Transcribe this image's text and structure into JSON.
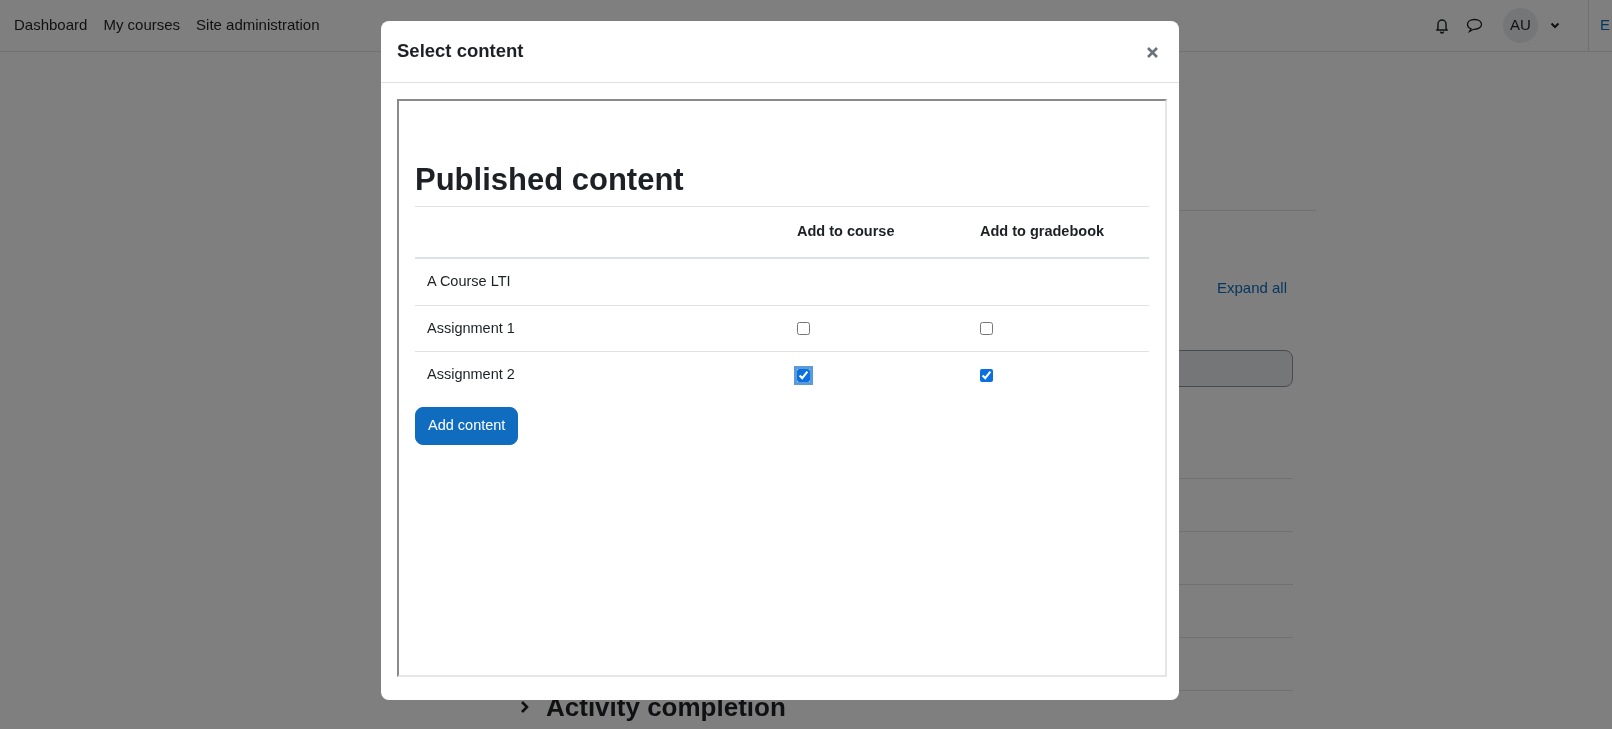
{
  "navbar": {
    "links": [
      {
        "label": "Dashboard"
      },
      {
        "label": "My courses"
      },
      {
        "label": "Site administration"
      }
    ],
    "avatar": {
      "initials": "AU"
    },
    "edge_text": "E"
  },
  "page": {
    "expand_all": "Expand all",
    "section_heading": "Activity completion"
  },
  "modal": {
    "title": "Select content",
    "heading": "Published content",
    "columns": [
      "Add to course",
      "Add to gradebook"
    ],
    "rows": [
      {
        "kind": "course",
        "label": "A Course LTI"
      },
      {
        "kind": "item",
        "label": "Assignment 1",
        "add_to_course": {
          "checked": false,
          "focused": false
        },
        "add_to_gradebook": {
          "checked": false,
          "focused": false
        }
      },
      {
        "kind": "item",
        "label": "Assignment 2",
        "add_to_course": {
          "checked": true,
          "focused": true
        },
        "add_to_gradebook": {
          "checked": true,
          "focused": false
        }
      }
    ],
    "button": "Add content"
  }
}
